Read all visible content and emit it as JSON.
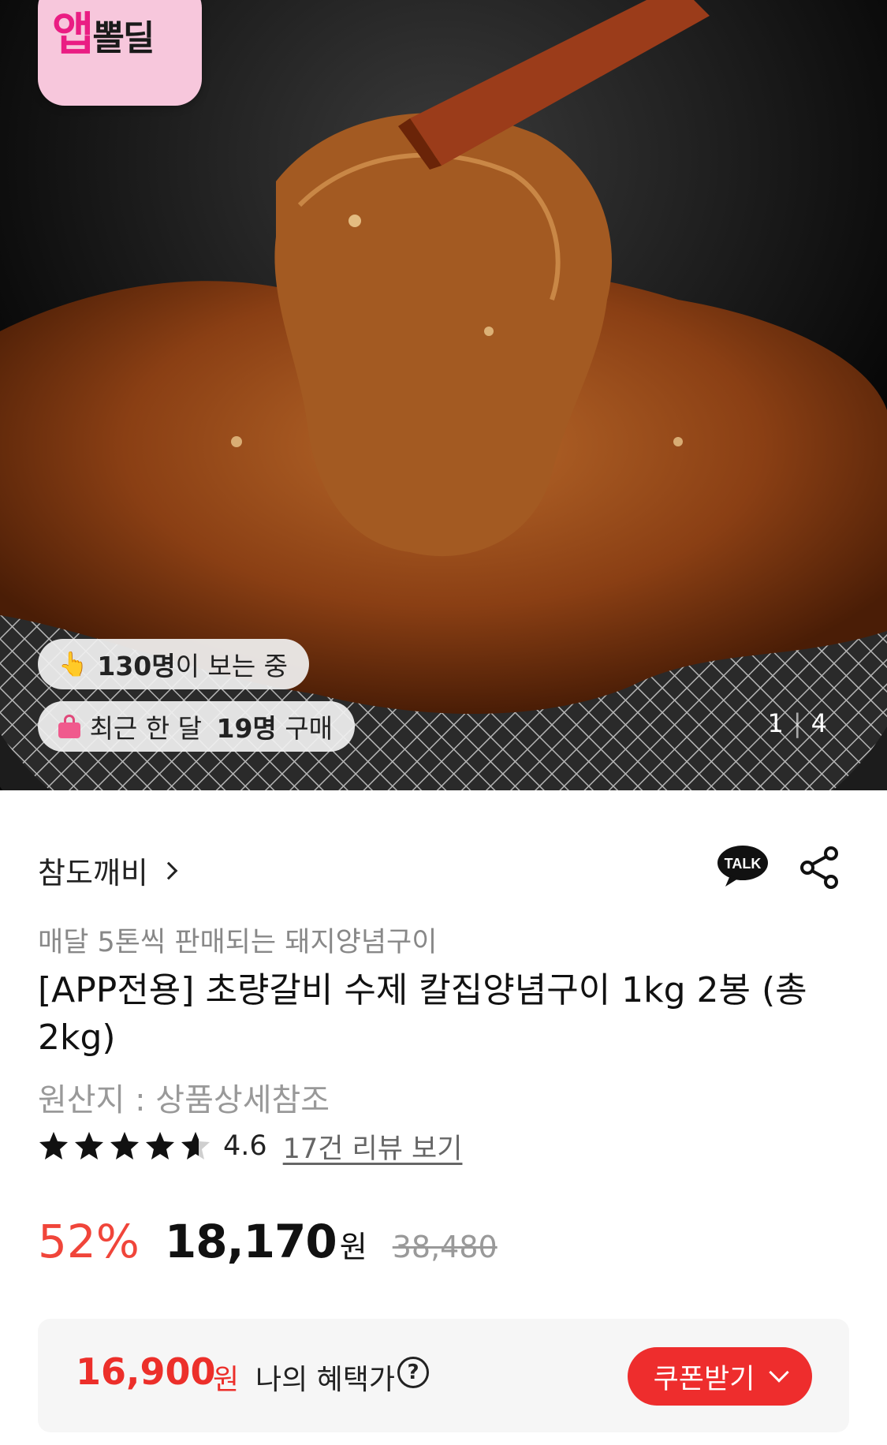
{
  "hero": {
    "badge_big": "앱",
    "badge_small": "뽈딜",
    "viewers_pre": "",
    "viewers_count": "130명",
    "viewers_suffix": "이 보는 중",
    "buyers_prefix": "최근 한 달 ",
    "buyers_count": "19명",
    "buyers_suffix": " 구매",
    "pager_current": "1",
    "pager_total": "4"
  },
  "seller": {
    "name": "참도깨비",
    "talk_label": "TALK"
  },
  "product": {
    "subtitle": "매달 5톤씩 판매되는 돼지양념구이",
    "title": "[APP전용] 초량갈비 수제 칼집양념구이 1kg 2봉 (총2kg)",
    "origin": "원산지 : 상품상세참조",
    "rating": "4.6",
    "rating_fraction": 0.92,
    "review_link": "17건 리뷰 보기"
  },
  "price": {
    "discount": "52%",
    "sale": "18,170",
    "unit": "원",
    "original": "38,480"
  },
  "benefit": {
    "price": "16,900",
    "unit": "원",
    "label": "나의 혜택가",
    "help": "?",
    "coupon_label": "쿠폰받기"
  },
  "colors": {
    "accent": "#ee2d2d",
    "discount": "#f0453a",
    "badge_bg": "#f7c7dc",
    "badge_brand": "#ea1d83"
  }
}
